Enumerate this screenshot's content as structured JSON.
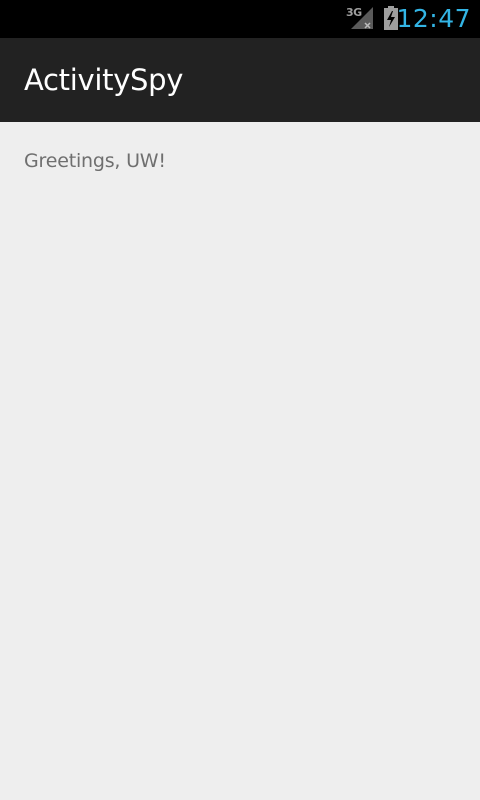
{
  "status_bar": {
    "network_label": "3G",
    "time": "12:47",
    "icons": [
      "signal-icon",
      "no-data-icon",
      "battery-charging-icon"
    ],
    "clock_color": "#33b5e5",
    "icon_color": "#9e9e9e"
  },
  "action_bar": {
    "title": "ActivitySpy",
    "background_color": "#222222"
  },
  "content": {
    "message": "Greetings, UW!",
    "background_color": "#eeeeee",
    "text_color": "#6f6f6f"
  }
}
